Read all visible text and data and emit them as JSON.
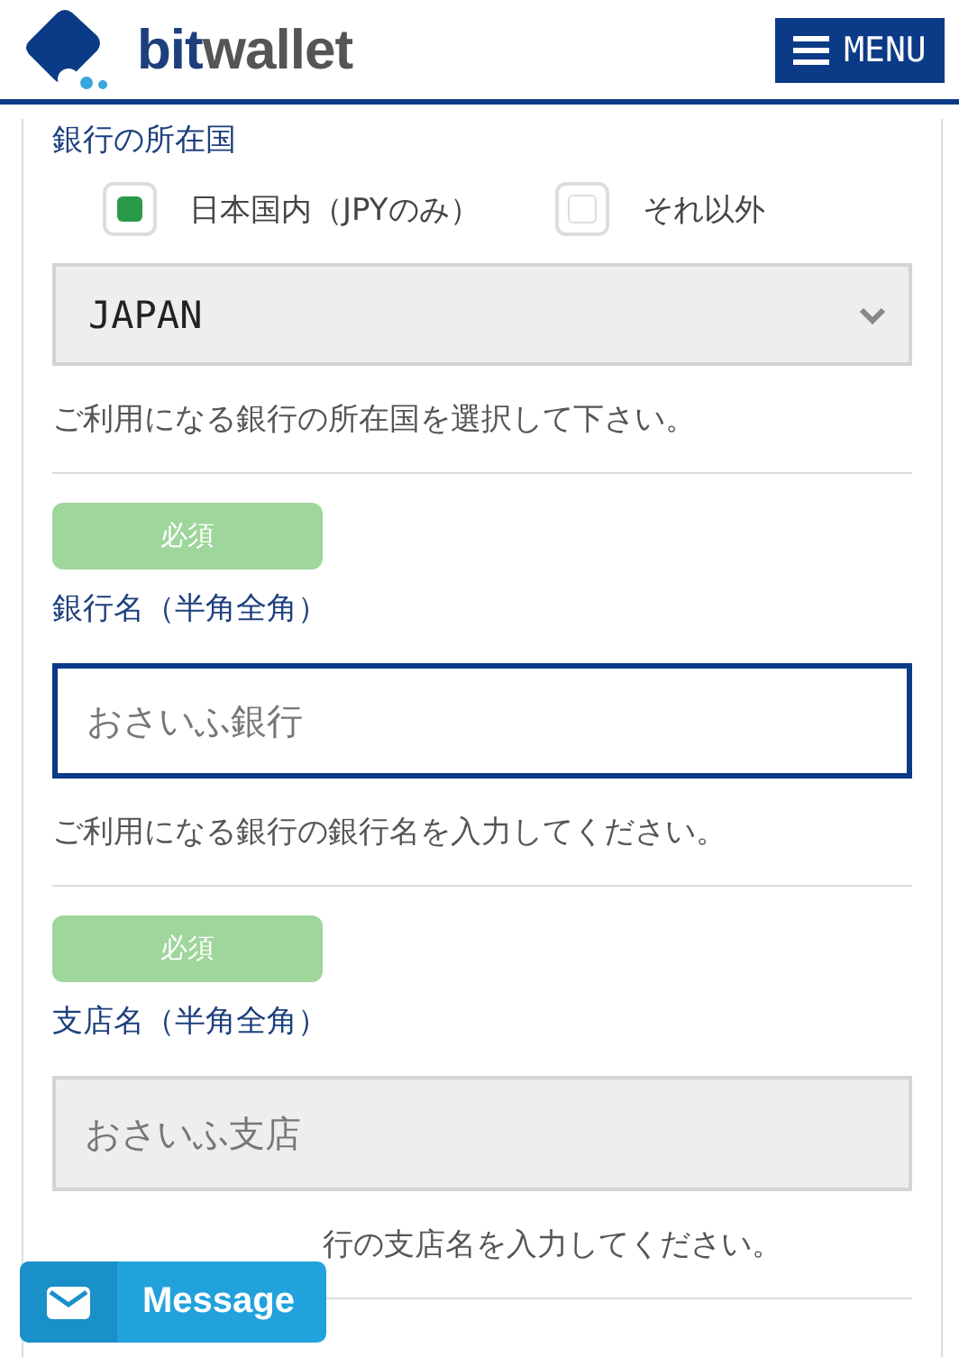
{
  "header": {
    "logo_primary": "bit",
    "logo_secondary": "wallet",
    "menu_button": "MENU"
  },
  "country": {
    "label": "銀行の所在国",
    "options": [
      {
        "label": "日本国内（JPYのみ）",
        "checked": true
      },
      {
        "label": "それ以外",
        "checked": false
      }
    ],
    "select_value": "JAPAN",
    "help": "ご利用になる銀行の所在国を選択して下さい。"
  },
  "fields": [
    {
      "badge": "必須",
      "label": "銀行名（半角全角）",
      "placeholder": "おさいふ銀行",
      "focused": true,
      "help": "ご利用になる銀行の銀行名を入力してください。"
    },
    {
      "badge": "必須",
      "label": "支店名（半角全角）",
      "placeholder": "おさいふ支店",
      "focused": false,
      "help": "行の支店名を入力してください。"
    }
  ],
  "message_button": "Message"
}
